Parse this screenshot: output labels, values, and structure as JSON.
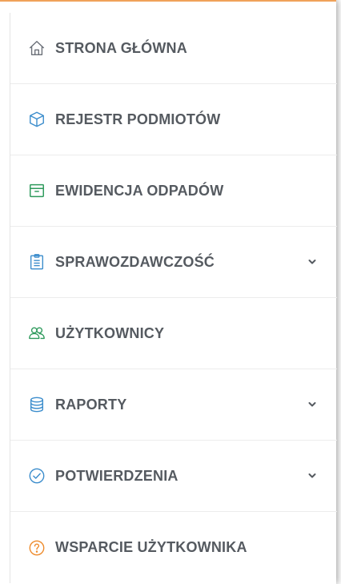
{
  "colors": {
    "accent_top": "#f0a25a",
    "text": "#555a60",
    "icon_gray": "#6b7078",
    "icon_blue": "#3a8ccc",
    "icon_green": "#2e9a5c",
    "icon_orange": "#ee8a2a"
  },
  "nav": {
    "items": [
      {
        "label": "STRONA GŁÓWNA",
        "icon": "home-icon",
        "has_dropdown": false
      },
      {
        "label": "REJESTR PODMIOTÓW",
        "icon": "cube-icon",
        "has_dropdown": false
      },
      {
        "label": "EWIDENCJA ODPADÓW",
        "icon": "archive-box-icon",
        "has_dropdown": false
      },
      {
        "label": "SPRAWOZDAWCZOŚĆ",
        "icon": "clipboard-icon",
        "has_dropdown": true
      },
      {
        "label": "UŻYTKOWNICY",
        "icon": "users-icon",
        "has_dropdown": false
      },
      {
        "label": "RAPORTY",
        "icon": "database-icon",
        "has_dropdown": true
      },
      {
        "label": "POTWIERDZENIA",
        "icon": "check-circle-icon",
        "has_dropdown": true
      },
      {
        "label": "WSPARCIE UŻYTKOWNIKA",
        "icon": "question-circle-icon",
        "has_dropdown": false
      }
    ]
  }
}
